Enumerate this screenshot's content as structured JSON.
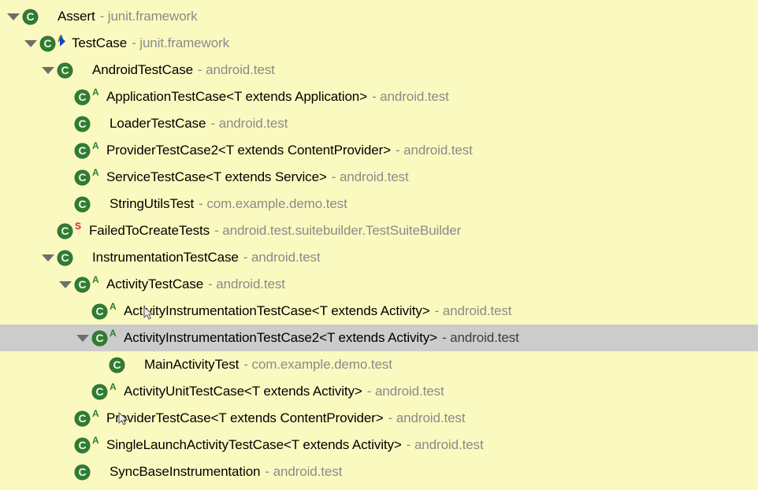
{
  "view": {
    "name": "class-hierarchy-tree",
    "background_color": "#fafac0",
    "selection_color": "#cccccc",
    "label_color": "#000000",
    "package_color": "#8a8a8a",
    "class_icon_color": "#2f7d32",
    "abstract_marker_color": "#2f7d32",
    "static_marker_color": "#e01b3c"
  },
  "rows": [
    {
      "name": "Assert",
      "package": "- junit.framework",
      "depth": 1,
      "expandable": true,
      "expanded": true,
      "modifier": "",
      "selected": false
    },
    {
      "name": "TestCase",
      "package": "- junit.framework",
      "depth": 2,
      "expandable": true,
      "expanded": true,
      "modifier": "A",
      "selected": false
    },
    {
      "name": "AndroidTestCase",
      "package": "- android.test",
      "depth": 3,
      "expandable": true,
      "expanded": true,
      "modifier": "",
      "selected": false
    },
    {
      "name": "ApplicationTestCase<T extends Application>",
      "package": "- android.test",
      "depth": 4,
      "expandable": false,
      "expanded": false,
      "modifier": "A",
      "selected": false
    },
    {
      "name": "LoaderTestCase",
      "package": "- android.test",
      "depth": 4,
      "expandable": false,
      "expanded": false,
      "modifier": "",
      "selected": false
    },
    {
      "name": "ProviderTestCase2<T extends ContentProvider>",
      "package": "- android.test",
      "depth": 4,
      "expandable": false,
      "expanded": false,
      "modifier": "A",
      "selected": false
    },
    {
      "name": "ServiceTestCase<T extends Service>",
      "package": "- android.test",
      "depth": 4,
      "expandable": false,
      "expanded": false,
      "modifier": "A",
      "selected": false
    },
    {
      "name": "StringUtilsTest",
      "package": "- com.example.demo.test",
      "depth": 4,
      "expandable": false,
      "expanded": false,
      "modifier": "",
      "selected": false
    },
    {
      "name": "FailedToCreateTests",
      "package": "- android.test.suitebuilder.TestSuiteBuilder",
      "depth": 3,
      "expandable": false,
      "expanded": false,
      "modifier": "S",
      "selected": false
    },
    {
      "name": "InstrumentationTestCase",
      "package": "- android.test",
      "depth": 3,
      "expandable": true,
      "expanded": true,
      "modifier": "",
      "selected": false
    },
    {
      "name": "ActivityTestCase",
      "package": "- android.test",
      "depth": 4,
      "expandable": true,
      "expanded": true,
      "modifier": "A",
      "selected": false
    },
    {
      "name": "ActivityInstrumentationTestCase<T extends Activity>",
      "package": "- android.test",
      "depth": 5,
      "expandable": false,
      "expanded": false,
      "modifier": "A",
      "selected": false
    },
    {
      "name": "ActivityInstrumentationTestCase2<T extends Activity>",
      "package": "- android.test",
      "depth": 5,
      "expandable": true,
      "expanded": true,
      "modifier": "A",
      "selected": true
    },
    {
      "name": "MainActivityTest",
      "package": "- com.example.demo.test",
      "depth": 6,
      "expandable": false,
      "expanded": false,
      "modifier": "",
      "selected": false
    },
    {
      "name": "ActivityUnitTestCase<T extends Activity>",
      "package": "- android.test",
      "depth": 5,
      "expandable": false,
      "expanded": false,
      "modifier": "A",
      "selected": false
    },
    {
      "name": "ProviderTestCase<T extends ContentProvider>",
      "package": "- android.test",
      "depth": 4,
      "expandable": false,
      "expanded": false,
      "modifier": "A",
      "selected": false
    },
    {
      "name": "SingleLaunchActivityTestCase<T extends Activity>",
      "package": "- android.test",
      "depth": 4,
      "expandable": false,
      "expanded": false,
      "modifier": "A",
      "selected": false
    },
    {
      "name": "SyncBaseInstrumentation",
      "package": "- android.test",
      "depth": 4,
      "expandable": false,
      "expanded": false,
      "modifier": "",
      "selected": false
    }
  ]
}
